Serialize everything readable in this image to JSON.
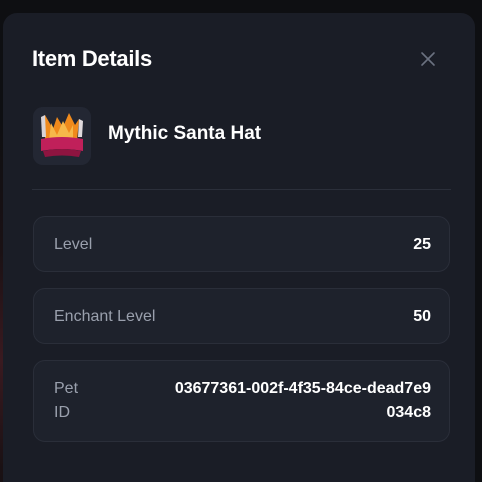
{
  "modal": {
    "title": "Item Details"
  },
  "item": {
    "name": "Mythic Santa Hat",
    "icon": "santa-hat-icon"
  },
  "details": {
    "level_label": "Level",
    "level_value": "25",
    "enchant_label": "Enchant Level",
    "enchant_value": "50",
    "pet_id_label": "Pet ID",
    "pet_id_value": "03677361-002f-4f35-84ce-dead7e9034c8"
  },
  "colors": {
    "modal_bg": "#1a1d26",
    "row_bg": "#1e222c",
    "label": "#9aa0ad",
    "value": "#ffffff"
  }
}
